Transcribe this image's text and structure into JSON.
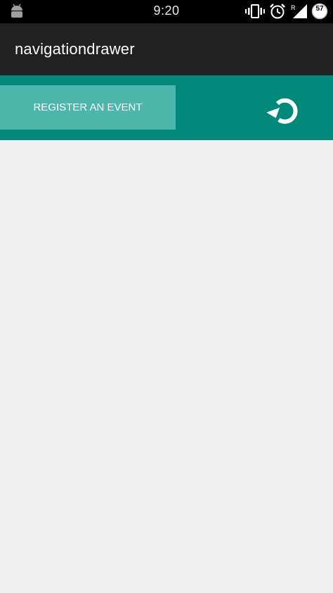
{
  "status_bar": {
    "time": "9:20",
    "battery_level": "57",
    "roaming_indicator": "R",
    "icons": [
      "android-icon",
      "vibrate-icon",
      "alarm-icon",
      "signal-icon",
      "battery-icon"
    ]
  },
  "app_bar": {
    "title": "navigationdrawer"
  },
  "actions": {
    "register_label": "REGISTER AN EVENT",
    "refresh_icon": "refresh-icon"
  },
  "colors": {
    "status_bar": "#000000",
    "app_bar": "#212121",
    "primary": "#00897b",
    "button": "#4db6ac",
    "background": "#eeeeee"
  }
}
